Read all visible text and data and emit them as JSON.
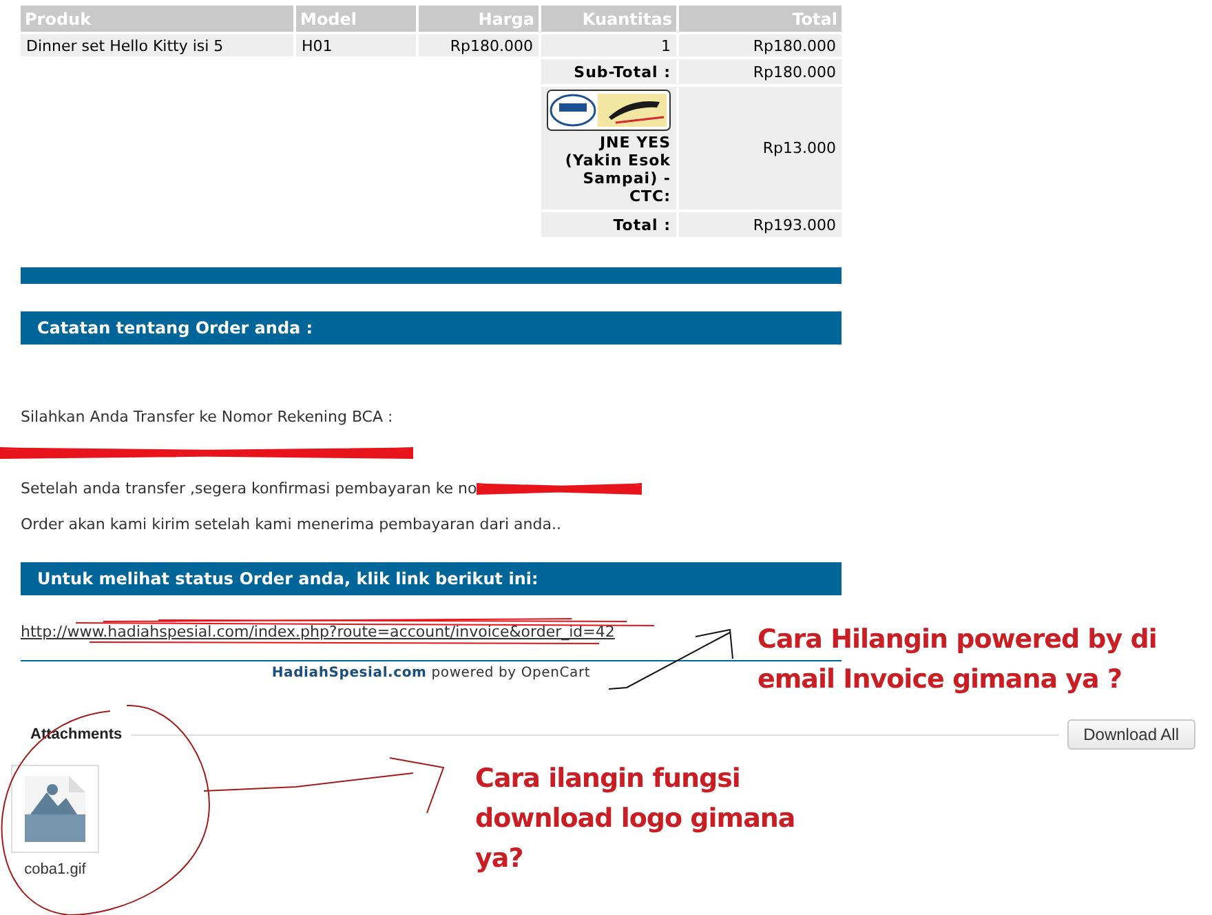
{
  "order_table": {
    "columns": [
      {
        "label": "Produk"
      },
      {
        "label": "Model"
      },
      {
        "label": "Harga"
      },
      {
        "label": "Kuantitas"
      },
      {
        "label": "Total"
      }
    ],
    "rows": [
      {
        "cells": [
          "Dinner set Hello Kitty isi 5",
          "H01",
          "Rp180.000",
          "1",
          "Rp180.000"
        ]
      }
    ],
    "totals": [
      {
        "kind": "plain",
        "label": "Sub-Total :",
        "value": "Rp180.000"
      },
      {
        "kind": "shipping",
        "label": "JNE YES (Yakin Esok Sampai) - CTC:",
        "value": "Rp13.000"
      },
      {
        "kind": "plain",
        "label": "Total :",
        "value": "Rp193.000"
      }
    ]
  },
  "notes": {
    "heading": "Catatan tentang Order anda :",
    "lines": [
      {
        "text": "Silahkan Anda Transfer ke Nomor Rekening BCA :",
        "redacted": false
      },
      {
        "redacted": true
      },
      {
        "text": "Setelah anda transfer ,segera konfirmasi pembayaran ke no",
        "redacted": true
      },
      {
        "text": "Order akan kami kirim setelah kami menerima pembayaran dari anda..",
        "redacted": false
      }
    ]
  },
  "status": {
    "heading": "Untuk melihat status Order anda, klik link berikut ini:",
    "link": "http://www.hadiahspesial.com/index.php?route=account/invoice&order_id=42",
    "redacted": true
  },
  "footer": {
    "brand": "HadiahSpesial.com",
    "text": "powered by OpenCart"
  },
  "attachments": {
    "title": "Attachments",
    "download_all": "Download All",
    "files": [
      {
        "name": "coba1.gif"
      }
    ]
  },
  "annotations": [
    {
      "text": "Cara Hilangin powered by di email Invoice gimana ya ?"
    },
    {
      "text": "Cara ilangin fungsi download logo gimana ya?"
    }
  ]
}
